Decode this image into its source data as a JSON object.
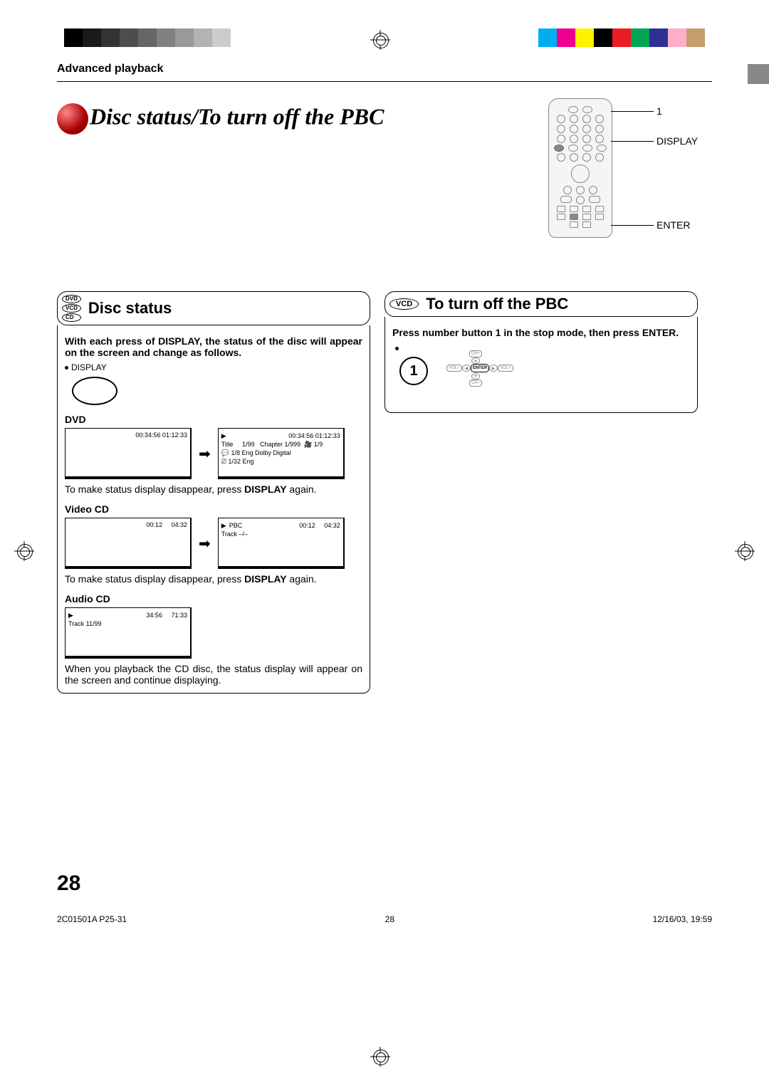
{
  "header": {
    "section": "Advanced playback",
    "title": "Disc status/To turn off the PBC"
  },
  "remote": {
    "label1": "1",
    "labelDisplay": "DISPLAY",
    "labelEnter": "ENTER"
  },
  "left": {
    "badge": {
      "dvd": "DVD",
      "vcd": "VCD",
      "cd": "CD"
    },
    "heading": "Disc status",
    "intro": "With each press of DISPLAY, the status of the disc will appear on the screen and change as follows.",
    "displayBullet": "DISPLAY",
    "dvd": {
      "label": "DVD",
      "screen1": {
        "time": "00:34:56  01:12:33"
      },
      "screen2": {
        "time": "00:34:56  01:12:33",
        "line1a": "Title",
        "line1b": "1/99",
        "line1c": "Chapter  1/999",
        "line1d": "1/9",
        "line2": "1/8  Eng Dolby Digital",
        "line3": "1/32  Eng"
      },
      "note_a": "To make status display disappear, press ",
      "note_b": "DISPLAY",
      "note_c": " again."
    },
    "vcd": {
      "label": "Video CD",
      "screen1": {
        "t1": "00:12",
        "t2": "04:32"
      },
      "screen2": {
        "pbc": "PBC",
        "t1": "00:12",
        "t2": "04:32",
        "track": "Track    –/–"
      },
      "note_a": "To make status display disappear, press ",
      "note_b": "DISPLAY",
      "note_c": " again."
    },
    "cd": {
      "label": "Audio CD",
      "screen": {
        "t1": "34:56",
        "t2": "71:33",
        "track": "Track 11/99"
      },
      "note": "When you playback the CD disc, the status display will appear on the screen and continue displaying."
    }
  },
  "right": {
    "badge": "VCD",
    "heading": "To turn off the PBC",
    "intro": "Press number button 1 in the stop mode, then press ENTER.",
    "enterPad": {
      "chUp": "CH+",
      "chDn": "CH–",
      "volM": "VOL–",
      "volP": "VOL+",
      "enter": "ENTER",
      "l": "◀",
      "r": "▶",
      "u": "▲",
      "d": "▼"
    }
  },
  "pageNum": "28",
  "footer": {
    "left": "2C01501A P25-31",
    "center": "28",
    "right": "12/16/03, 19:59"
  }
}
